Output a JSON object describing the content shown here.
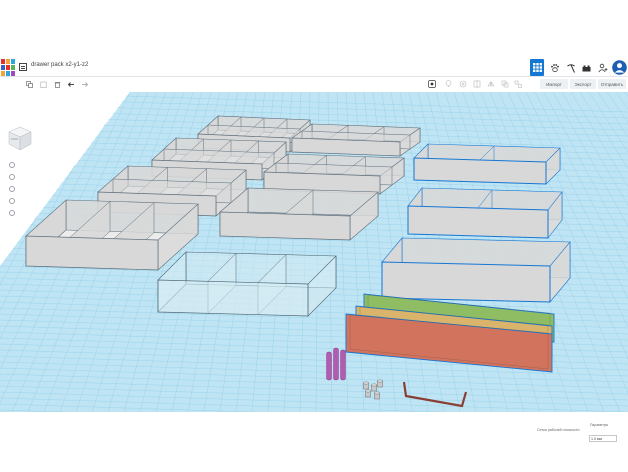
{
  "document": {
    "title": "drawer pack x2-y1-z2"
  },
  "toolbar": {
    "import_label": "Импорт",
    "export_label": "Экспорт",
    "send_label": "Отправить"
  },
  "workplane": {
    "grid_info_label": "Сетка рабочей плоскости",
    "snap_label": "Параметры",
    "snap_value": "1.0 мм"
  },
  "colors": {
    "grid_bg": "#bfe4f3",
    "grid_line": "#7dc7e8",
    "selection": "#1477d4",
    "divider_green": "#8fbd63",
    "divider_yellow": "#d9b46a",
    "divider_red": "#d2735e",
    "peg_purple": "#b35bb0",
    "box_light": "#d8d8d8",
    "box_outline": "#5a6c7a"
  },
  "icons": {
    "grid": "grid-view-icon",
    "paw": "paw-icon",
    "pickaxe": "pickaxe-icon",
    "brick": "brick-icon",
    "add_user": "add-user-icon",
    "avatar": "avatar-icon"
  }
}
